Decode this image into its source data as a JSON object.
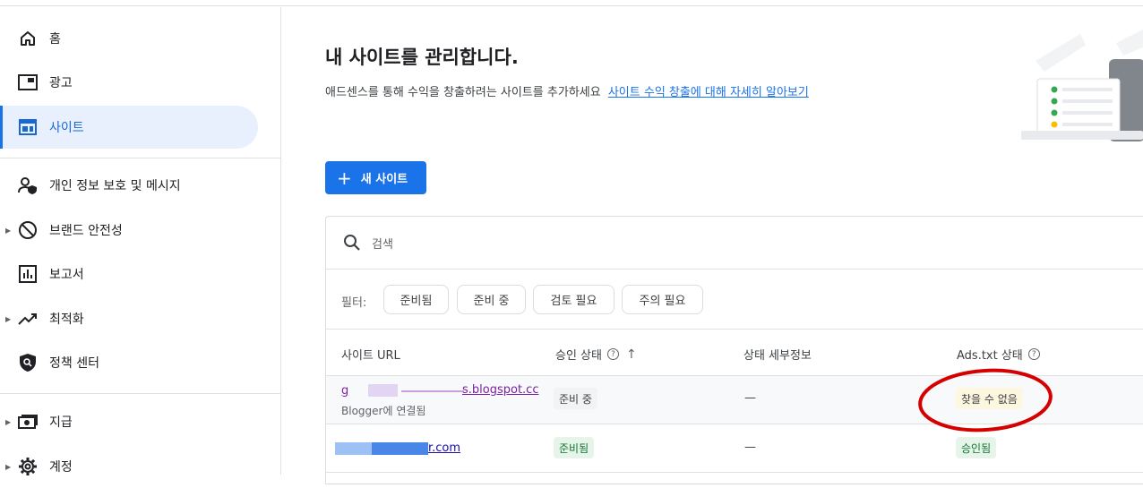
{
  "sidebar": {
    "items": [
      {
        "label": "홈",
        "icon": "home-icon"
      },
      {
        "label": "광고",
        "icon": "ads-icon"
      },
      {
        "label": "사이트",
        "icon": "sites-icon"
      },
      {
        "label": "개인 정보 보호 및 메시지",
        "icon": "privacy-icon"
      },
      {
        "label": "브랜드 안전성",
        "icon": "block-icon"
      },
      {
        "label": "보고서",
        "icon": "reports-icon"
      },
      {
        "label": "최적화",
        "icon": "trending-icon"
      },
      {
        "label": "정책 센터",
        "icon": "policy-icon"
      },
      {
        "label": "지급",
        "icon": "payments-icon"
      },
      {
        "label": "계정",
        "icon": "gear-icon"
      }
    ]
  },
  "main": {
    "title": "내 사이트를 관리합니다.",
    "subtitle": "애드센스를 통해 수익을 창출하려는 사이트를 추가하세요",
    "learn_more_link": "사이트 수익 창출에 대해 자세히 알아보기",
    "new_site_button": "새 사이트",
    "search_placeholder": "검색",
    "filter_label": "필터:",
    "filters": [
      "준비됨",
      "준비 중",
      "검토 필요",
      "주의 필요"
    ],
    "columns": {
      "site_url": "사이트 URL",
      "approval_status": "승인 상태",
      "status_details": "상태 세부정보",
      "ads_txt_status": "Ads.txt 상태"
    },
    "rows": [
      {
        "url_visible": "s.blogspot.cc",
        "url_prefix": "g",
        "sub": "Blogger에 연결됨",
        "approval": "준비 중",
        "details": "—",
        "ads_txt": "찾을 수 없음"
      },
      {
        "url_visible": "r.com",
        "sub": "",
        "approval": "준비됨",
        "details": "—",
        "ads_txt": "승인됨"
      }
    ]
  },
  "colors": {
    "accent": "#1a73e8",
    "active_nav_bg": "#e8f0fe",
    "annotation_circle": "#d50000",
    "approved_bg": "#e6f4ea",
    "warning_bg": "#fef7e0"
  }
}
